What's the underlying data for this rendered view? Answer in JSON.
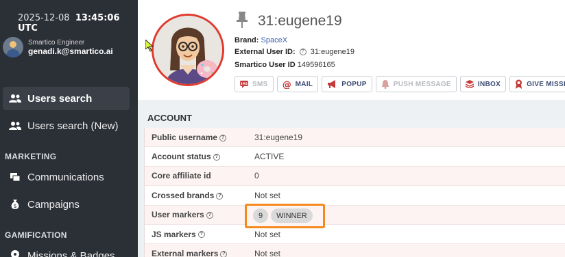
{
  "sidebar": {
    "date": "2025-12-08",
    "time": "13:45:06 UTC",
    "user_role": "Smartico Engineer",
    "user_email": "genadi.k@smartico.ai",
    "items": [
      {
        "label": "Users search",
        "icon": "users-icon"
      },
      {
        "label": "Users search (New)",
        "icon": "users-icon"
      },
      {
        "label": "Communications",
        "icon": "communications-icon"
      },
      {
        "label": "Campaigns",
        "icon": "money-bag-icon"
      },
      {
        "label": "Missions & Badges",
        "icon": "location-pin-icon"
      }
    ],
    "sections": {
      "marketing": "MARKETING",
      "gamification": "GAMIFICATION"
    }
  },
  "header": {
    "title": "31:eugene19",
    "brand_label": "Brand:",
    "brand_value": "SpaceX",
    "external_label": "External User ID:",
    "external_value": "31:eugene19",
    "smartico_label": "Smartico User ID",
    "smartico_value": "149596165",
    "buttons": {
      "sms": "SMS",
      "mail": "MAIL",
      "popup": "POPUP",
      "push": "PUSH MESSAGE",
      "inbox": "INBOX",
      "give_mission": "GIVE MISSION"
    }
  },
  "account": {
    "title": "ACCOUNT",
    "rows": [
      {
        "key": "Public username",
        "value": "31:eugene19"
      },
      {
        "key": "Account status",
        "value": "ACTIVE"
      },
      {
        "key": "Core affiliate id",
        "value": "0"
      },
      {
        "key": "Crossed brands",
        "value": "Not set"
      },
      {
        "key": "User markers",
        "value": ""
      },
      {
        "key": "JS markers",
        "value": "Not set"
      },
      {
        "key": "External markers",
        "value": "Not set"
      }
    ],
    "markers": {
      "count": "9",
      "label": "WINNER"
    }
  },
  "colors": {
    "sidebar_bg": "#2b2f36",
    "highlight": "#f28a1e",
    "avatar_ring": "#e03a2f"
  }
}
